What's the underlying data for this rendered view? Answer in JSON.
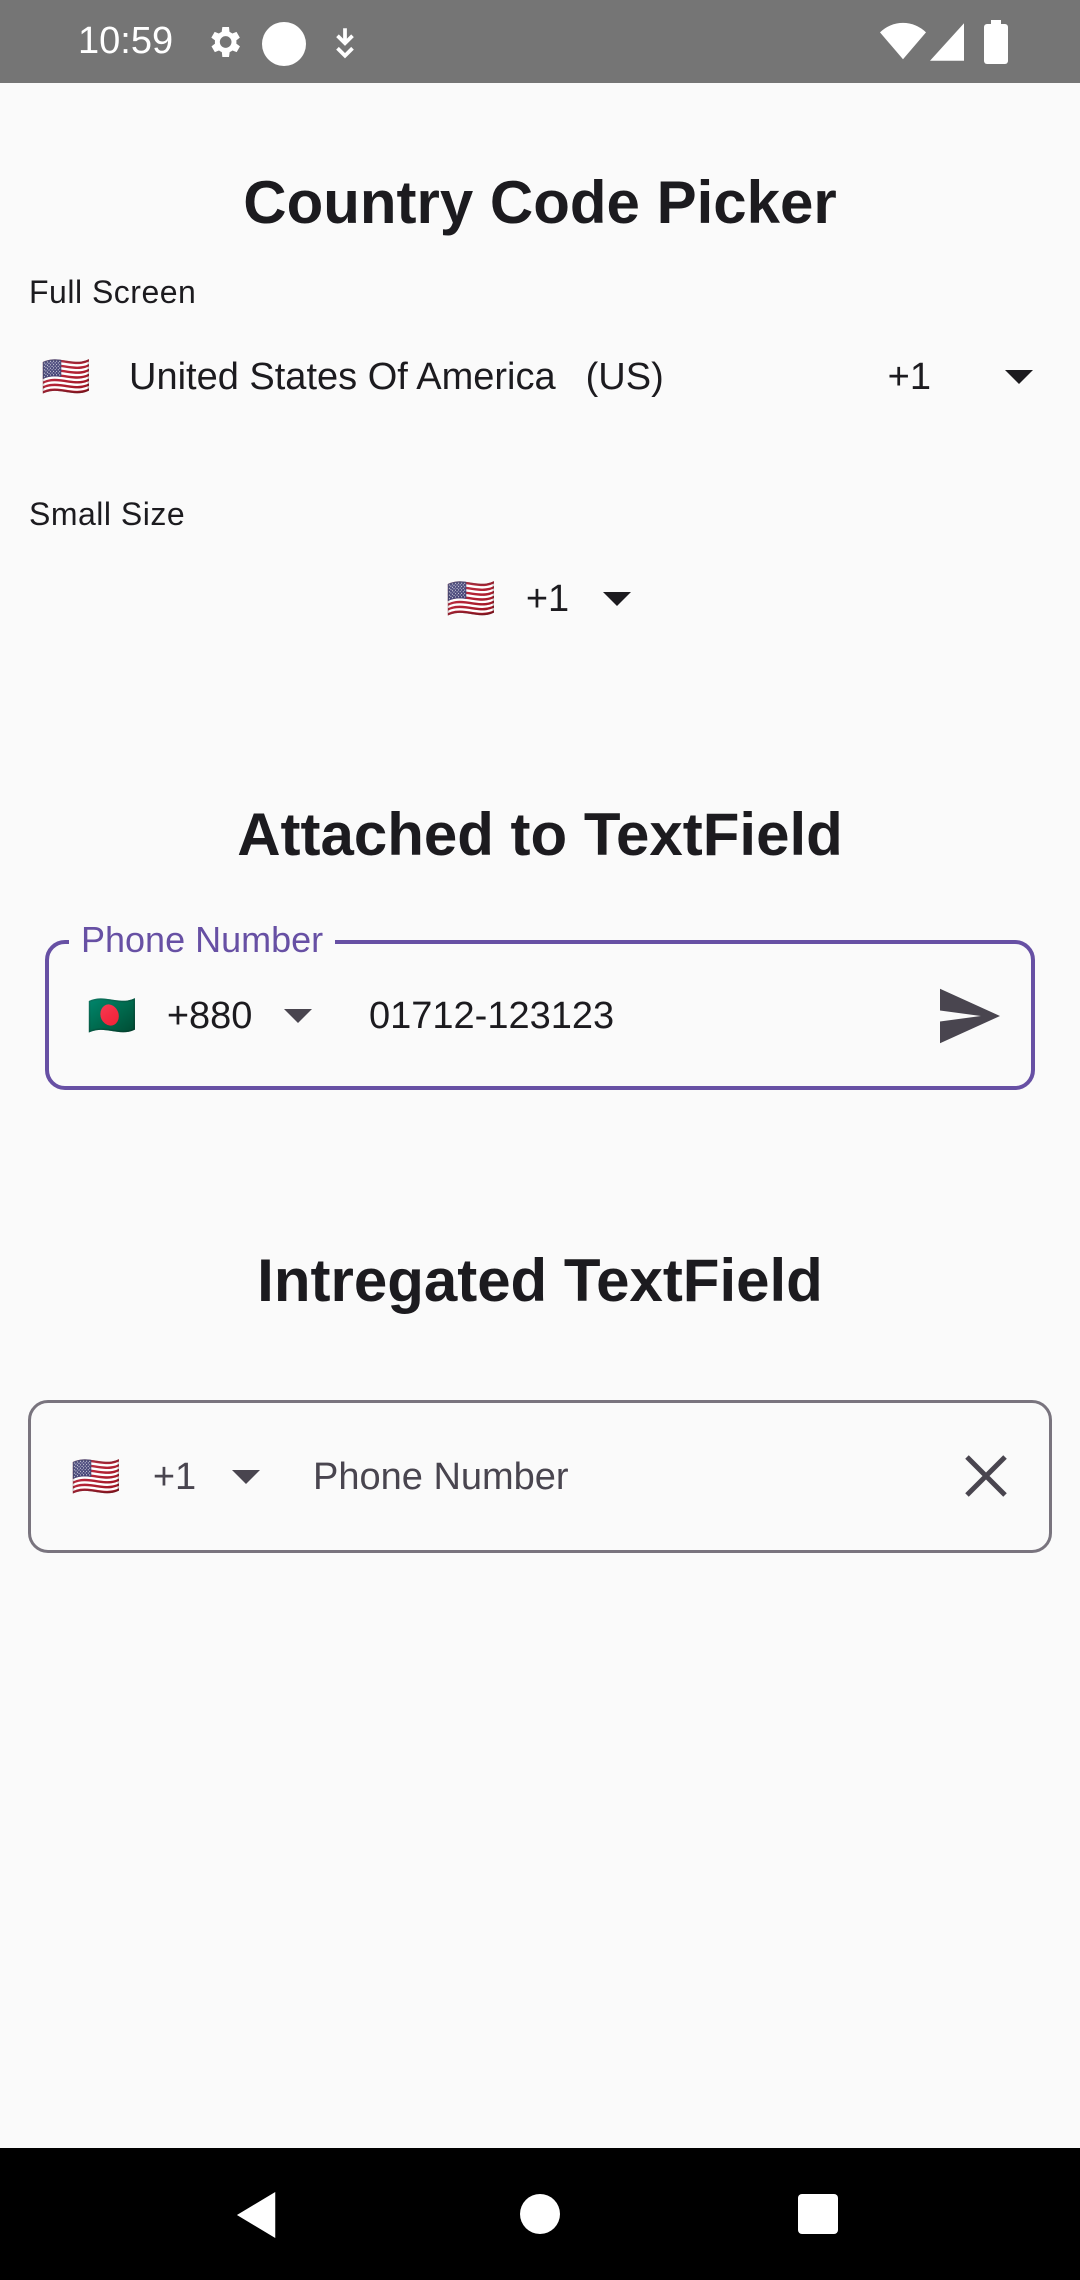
{
  "status_bar": {
    "time": "10:59",
    "icons": [
      "settings-gear-icon",
      "circle-dot-icon",
      "download-arrow-icon",
      "wifi-icon",
      "cell-signal-icon",
      "battery-icon"
    ],
    "color": "#757575"
  },
  "full_screen_section": {
    "title": "Country Code Picker",
    "label": "Full Screen",
    "picker": {
      "flag": "🇺🇸",
      "country_name": "United States Of America",
      "iso": "(US)",
      "dial_code": "+1"
    }
  },
  "small_size_section": {
    "label": "Small Size",
    "picker": {
      "flag": "🇺🇸",
      "dial_code": "+1"
    }
  },
  "attached_section": {
    "title": "Attached to TextField",
    "field_label": "Phone Number",
    "picker": {
      "flag": "🇧🇩",
      "dial_code": "+880"
    },
    "value": "01712-123123",
    "trailing_icon": "send-icon",
    "accent_color": "#6750a4"
  },
  "integrated_section": {
    "title": "Intregated TextField",
    "picker": {
      "flag": "🇺🇸",
      "dial_code": "+1"
    },
    "placeholder": "Phone Number",
    "value": "",
    "trailing_icon": "close-icon"
  },
  "nav_bar": {
    "buttons": [
      "back-icon",
      "home-icon",
      "recents-icon"
    ]
  }
}
